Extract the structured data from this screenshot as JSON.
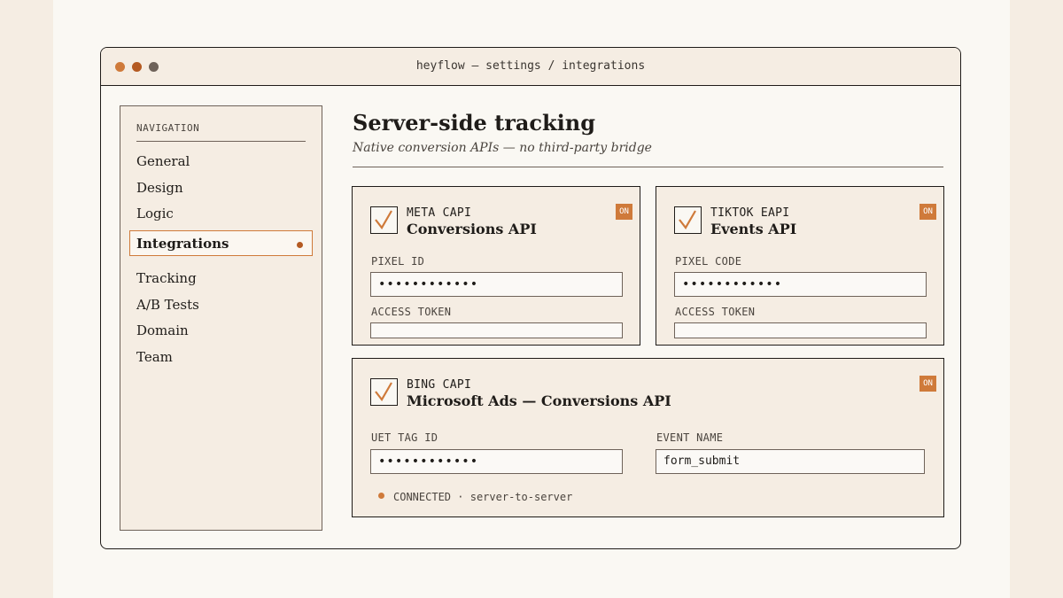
{
  "window": {
    "title": "heyflow — settings / integrations"
  },
  "sidebar": {
    "heading": "NAVIGATION",
    "items": [
      "General",
      "Design",
      "Logic",
      "Integrations",
      "Tracking",
      "A/B Tests",
      "Domain",
      "Team"
    ],
    "active": "Integrations"
  },
  "main": {
    "title": "Server-side tracking",
    "subtitle": "Native conversion APIs — no third-party bridge"
  },
  "cards": {
    "meta": {
      "kicker": "META CAPI",
      "title": "Conversions API",
      "badge": "ON",
      "checked": true,
      "field1_label": "PIXEL ID",
      "field1_value": "••••••••••••",
      "field2_label": "ACCESS TOKEN",
      "field2_value": ""
    },
    "tiktok": {
      "kicker": "TIKTOK EAPI",
      "title": "Events API",
      "badge": "ON",
      "checked": true,
      "field1_label": "PIXEL CODE",
      "field1_value": "••••••••••••",
      "field2_label": "ACCESS TOKEN",
      "field2_value": ""
    },
    "bing": {
      "kicker": "BING CAPI",
      "title": "Microsoft Ads — Conversions API",
      "badge": "ON",
      "checked": true,
      "field1_label": "UET TAG ID",
      "field1_value": "••••••••••••",
      "field2_label": "EVENT NAME",
      "field2_value": "form_submit",
      "status_label": "CONNECTED",
      "status_detail": "server-to-server"
    }
  },
  "colors": {
    "accent": "#cf7a3a",
    "ink": "#1f1c19",
    "paper": "#faf8f3",
    "panel": "#f5ede3"
  },
  "icons": {
    "check": "checkmark-icon",
    "window_controls": [
      "window-dot-icon",
      "window-dot-icon",
      "window-dot-icon"
    ]
  }
}
